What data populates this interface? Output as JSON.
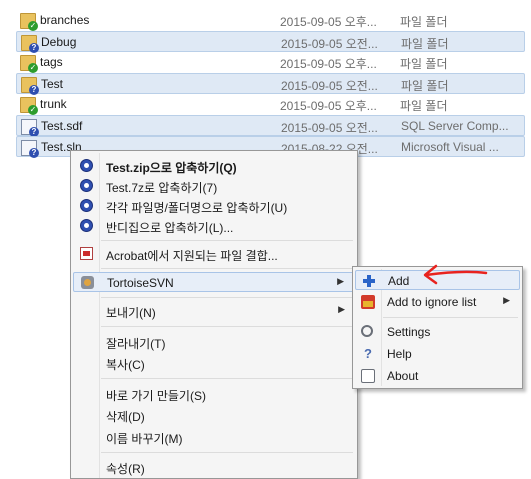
{
  "files": [
    {
      "name": "branches",
      "date": "2015-09-05 오후...",
      "type": "파일 폴더",
      "kind": "folder",
      "status": "ok",
      "selected": false
    },
    {
      "name": "Debug",
      "date": "2015-09-05 오전...",
      "type": "파일 폴더",
      "kind": "folder",
      "status": "q",
      "selected": true
    },
    {
      "name": "tags",
      "date": "2015-09-05 오후...",
      "type": "파일 폴더",
      "kind": "folder",
      "status": "ok",
      "selected": false
    },
    {
      "name": "Test",
      "date": "2015-09-05 오전...",
      "type": "파일 폴더",
      "kind": "folder",
      "status": "q",
      "selected": true
    },
    {
      "name": "trunk",
      "date": "2015-09-05 오후...",
      "type": "파일 폴더",
      "kind": "folder",
      "status": "ok",
      "selected": false
    },
    {
      "name": "Test.sdf",
      "date": "2015-09-05 오전...",
      "type": "SQL Server Comp...",
      "kind": "doc",
      "status": "q",
      "selected": true
    },
    {
      "name": "Test.sln",
      "date": "2015-08-22 오전...",
      "type": "Microsoft Visual ...",
      "kind": "doc",
      "status": "q",
      "selected": true
    }
  ],
  "context_menu": {
    "zip_test": "Test.zip으로 압축하기(Q)",
    "sevenzip_test": "Test.7z로 압축하기(7)",
    "zip_each": "각각 파일명/폴더명으로 압축하기(U)",
    "zip_bandizip": "반디집으로 압축하기(L)...",
    "acrobat_combine": "Acrobat에서 지원되는 파일 결합...",
    "tortoisesvn": "TortoiseSVN",
    "send_to": "보내기(N)",
    "cut": "잘라내기(T)",
    "copy": "복사(C)",
    "create_shortcut": "바로 가기 만들기(S)",
    "delete": "삭제(D)",
    "rename": "이름 바꾸기(M)",
    "properties": "속성(R)"
  },
  "submenu": {
    "add": "Add",
    "add_to_ignore": "Add to ignore list",
    "settings": "Settings",
    "help": "Help",
    "about": "About"
  },
  "arrows": {
    "submenu_arrow": "▶"
  },
  "colors": {
    "selection": "#dfe9f5",
    "annotation_red": "#e8231f"
  }
}
